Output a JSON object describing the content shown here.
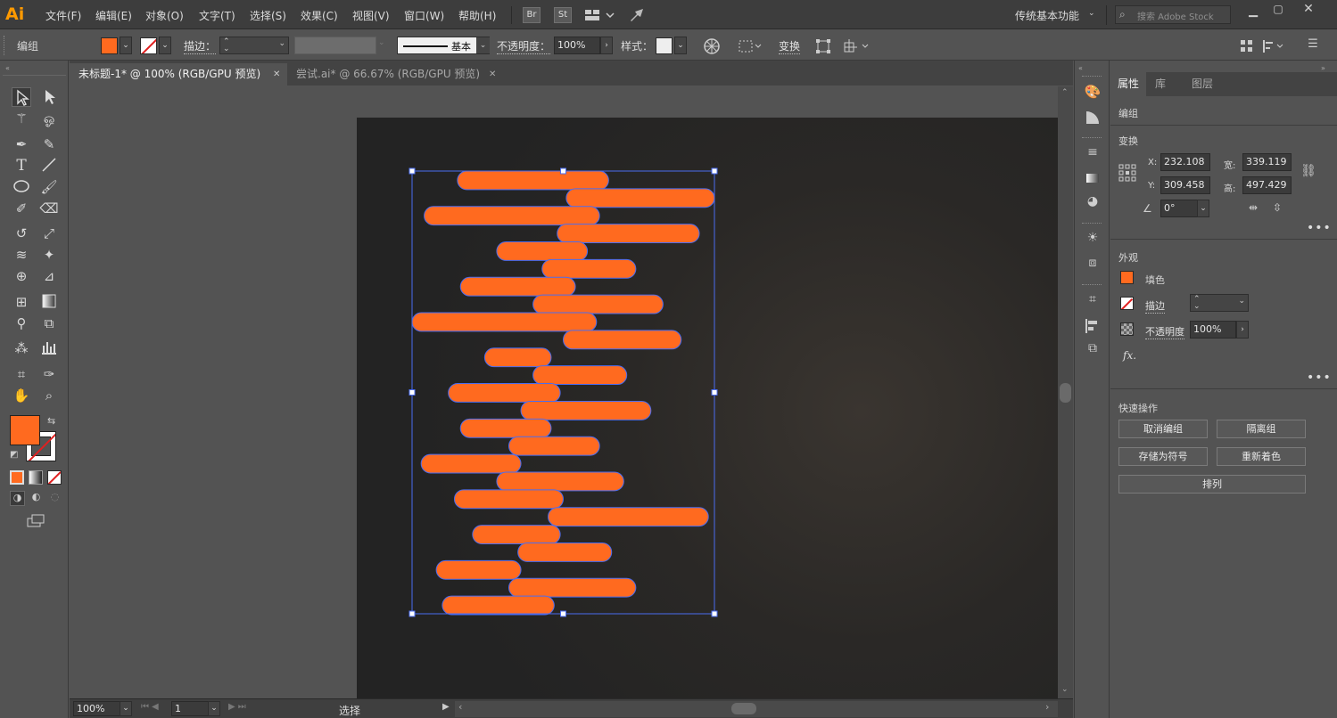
{
  "app": {
    "logo": "Ai"
  },
  "menu": [
    "文件(F)",
    "编辑(E)",
    "对象(O)",
    "文字(T)",
    "选择(S)",
    "效果(C)",
    "视图(V)",
    "窗口(W)",
    "帮助(H)"
  ],
  "menubar_buttons": {
    "br": "Br",
    "st": "St"
  },
  "workspace": "传统基本功能",
  "search": {
    "placeholder": "搜索 Adobe Stock"
  },
  "control": {
    "selection_label": "编组",
    "stroke_label": "描边：",
    "stroke_style": "基本",
    "opacity_label": "不透明度：",
    "opacity_value": "100%",
    "style_label": "样式：",
    "transform_label": "变换"
  },
  "tabs": [
    {
      "label": "未标题-1* @ 100% (RGB/GPU 预览)"
    },
    {
      "label": "尝试.ai* @ 66.67% (RGB/GPU 预览)"
    }
  ],
  "status": {
    "zoom": "100%",
    "page": "1",
    "tool": "选择"
  },
  "panel": {
    "tabs": [
      "属性",
      "库",
      "图层"
    ],
    "object_type": "编组",
    "transform": {
      "title": "变换",
      "x_label": "X:",
      "x_value": "232.108",
      "y_label": "Y:",
      "y_value": "309.458",
      "w_label": "宽:",
      "w_value": "339.119",
      "h_label": "高:",
      "h_value": "497.429",
      "angle_value": "0°"
    },
    "appearance": {
      "title": "外观",
      "fill_label": "填色",
      "stroke_label": "描边",
      "opacity_label": "不透明度",
      "opacity_value": "100%",
      "fx_label": "fx."
    },
    "quick_actions": {
      "title": "快速操作",
      "ungroup": "取消编组",
      "isolate": "隔离组",
      "save_symbol": "存储为符号",
      "recolor": "重新着色",
      "arrange": "排列"
    }
  },
  "colors": {
    "fill": "#ff6a1f",
    "selection": "#4a6cf0",
    "accent_logo": "#ff9a00"
  },
  "artwork": {
    "bars": [
      [
        0.15,
        0.65
      ],
      [
        0.51,
        1.0
      ],
      [
        0.04,
        0.62
      ],
      [
        0.48,
        0.95
      ],
      [
        0.28,
        0.58
      ],
      [
        0.43,
        0.74
      ],
      [
        0.16,
        0.54
      ],
      [
        0.4,
        0.83
      ],
      [
        0.0,
        0.61
      ],
      [
        0.5,
        0.89
      ],
      [
        0.24,
        0.46
      ],
      [
        0.4,
        0.71
      ],
      [
        0.12,
        0.49
      ],
      [
        0.36,
        0.79
      ],
      [
        0.16,
        0.46
      ],
      [
        0.32,
        0.62
      ],
      [
        0.03,
        0.36
      ],
      [
        0.28,
        0.7
      ],
      [
        0.14,
        0.5
      ],
      [
        0.45,
        0.98
      ],
      [
        0.2,
        0.49
      ],
      [
        0.35,
        0.66
      ],
      [
        0.08,
        0.36
      ],
      [
        0.32,
        0.74
      ],
      [
        0.1,
        0.47
      ]
    ]
  }
}
